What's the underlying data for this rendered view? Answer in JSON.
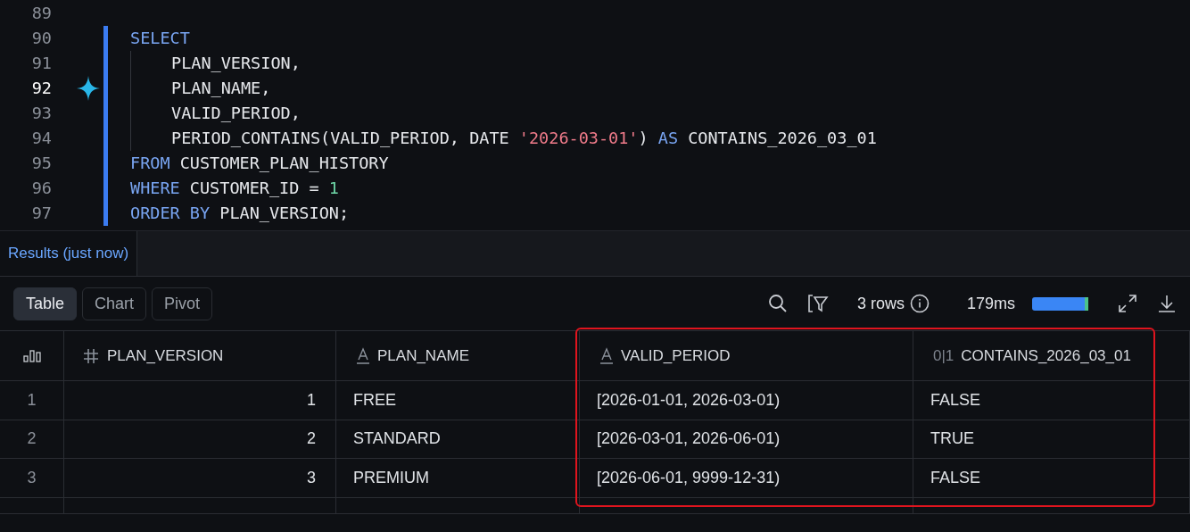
{
  "editor": {
    "lines": [
      {
        "number": "89",
        "active": false
      },
      {
        "number": "90",
        "active": false,
        "indented": false,
        "tokens": [
          {
            "kind": "keyword",
            "text": "SELECT"
          }
        ]
      },
      {
        "number": "91",
        "active": false,
        "indented": true,
        "tokens": [
          {
            "kind": "ident",
            "text": "PLAN_VERSION,"
          }
        ]
      },
      {
        "number": "92",
        "active": true,
        "indented": true,
        "tokens": [
          {
            "kind": "ident",
            "text": "PLAN_NAME,"
          }
        ]
      },
      {
        "number": "93",
        "active": false,
        "indented": true,
        "tokens": [
          {
            "kind": "ident",
            "text": "VALID_PERIOD,"
          }
        ]
      },
      {
        "number": "94",
        "active": false,
        "indented": true,
        "tokens": [
          {
            "kind": "ident",
            "text": "PERIOD_CONTAINS(VALID_PERIOD, DATE "
          },
          {
            "kind": "string",
            "text": "'2026-03-01'"
          },
          {
            "kind": "ident",
            "text": ") "
          },
          {
            "kind": "keyword",
            "text": "AS"
          },
          {
            "kind": "ident",
            "text": " CONTAINS_2026_03_01"
          }
        ]
      },
      {
        "number": "95",
        "active": false,
        "indented": false,
        "tokens": [
          {
            "kind": "keyword",
            "text": "FROM"
          },
          {
            "kind": "ident",
            "text": " CUSTOMER_PLAN_HISTORY"
          }
        ]
      },
      {
        "number": "96",
        "active": false,
        "indented": false,
        "tokens": [
          {
            "kind": "keyword",
            "text": "WHERE"
          },
          {
            "kind": "ident",
            "text": " CUSTOMER_ID = "
          },
          {
            "kind": "number",
            "text": "1"
          }
        ]
      },
      {
        "number": "97",
        "active": false,
        "indented": false,
        "tokens": [
          {
            "kind": "keyword",
            "text": "ORDER BY"
          },
          {
            "kind": "ident",
            "text": " PLAN_VERSION;"
          }
        ]
      }
    ]
  },
  "results_tab": {
    "label": "Results",
    "time": "(just now)"
  },
  "view_tabs": [
    {
      "label": "Table",
      "selected": true
    },
    {
      "label": "Chart",
      "selected": false
    },
    {
      "label": "Pivot",
      "selected": false
    }
  ],
  "toolbar": {
    "row_count": "3 rows",
    "duration": "179ms"
  },
  "table": {
    "columns": [
      {
        "name": "PLAN_VERSION",
        "kind": "number"
      },
      {
        "name": "PLAN_NAME",
        "kind": "text"
      },
      {
        "name": "VALID_PERIOD",
        "kind": "text"
      },
      {
        "name": "CONTAINS_2026_03_01",
        "kind": "boolean",
        "type_glyph": "0|1"
      }
    ],
    "highlight_box": true,
    "rows": [
      {
        "index": "1",
        "cells": [
          "1",
          "FREE",
          "[2026-01-01, 2026-03-01)",
          "FALSE"
        ]
      },
      {
        "index": "2",
        "cells": [
          "2",
          "STANDARD",
          "[2026-03-01, 2026-06-01)",
          "TRUE"
        ]
      },
      {
        "index": "3",
        "cells": [
          "3",
          "PREMIUM",
          "[2026-06-01, 9999-12-31)",
          "FALSE"
        ]
      }
    ]
  }
}
